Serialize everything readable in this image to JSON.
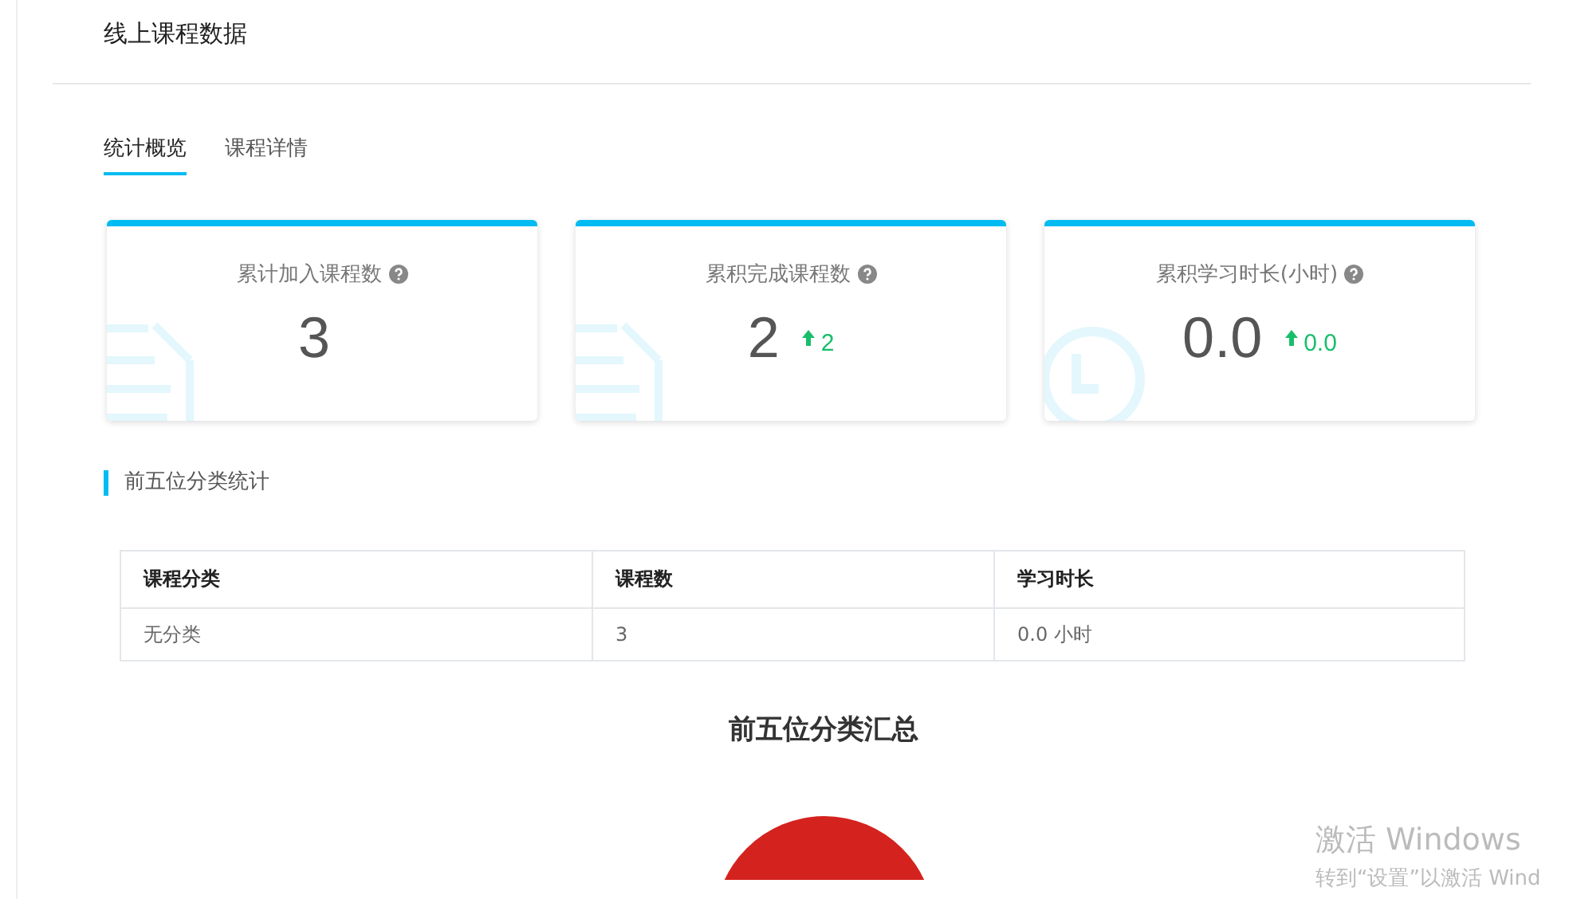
{
  "page": {
    "title": "线上课程数据"
  },
  "tabs": [
    {
      "label": "统计概览",
      "selected": true
    },
    {
      "label": "课程详情",
      "selected": false
    }
  ],
  "cards": [
    {
      "kind": "count",
      "label": "累计加入课程数",
      "value": "3"
    },
    {
      "kind": "count",
      "label": "累积完成课程数",
      "value": "2",
      "change": "2"
    },
    {
      "kind": "hours",
      "label": "累积学习时长(小时)",
      "value": "0.0",
      "change": "0.0"
    }
  ],
  "section": {
    "title": "前五位分类统计"
  },
  "table": {
    "columns": [
      "课程分类",
      "课程数",
      "学习时长"
    ],
    "rows": [
      [
        "无分类",
        "3",
        "0.0 小时"
      ]
    ]
  },
  "chart": {
    "title": "前五位分类汇总"
  },
  "watermark": {
    "title": "激活 Windows",
    "subtitle": "转到“设置”以激活 Wind"
  }
}
